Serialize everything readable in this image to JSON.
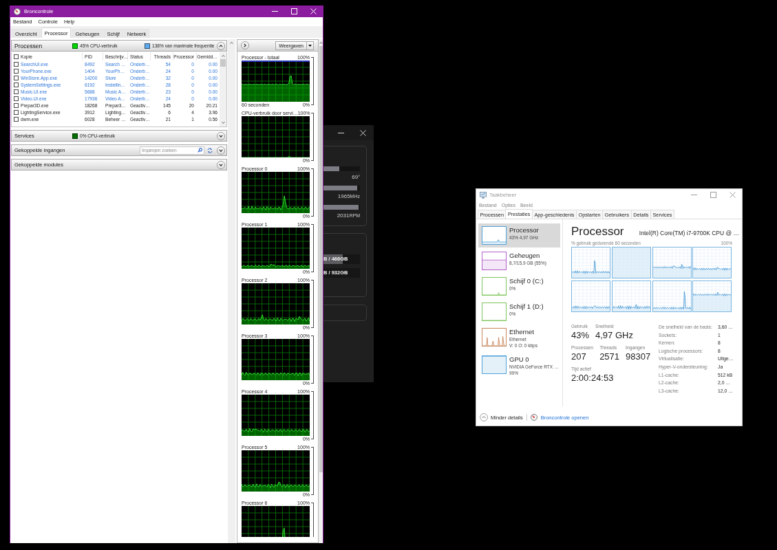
{
  "resource_monitor": {
    "title": "Broncontrole",
    "menu": [
      "Bestand",
      "Controle",
      "Help"
    ],
    "tabs": [
      {
        "label": "Overzicht",
        "selected": false
      },
      {
        "label": "Processor",
        "selected": true
      },
      {
        "label": "Geheugen",
        "selected": false
      },
      {
        "label": "Schijf",
        "selected": false
      },
      {
        "label": "Netwerk",
        "selected": false
      }
    ],
    "sections": [
      {
        "title": "Processen",
        "expanded": true,
        "indicators": [
          {
            "label": "45% CPU-verbruik",
            "color": "#00d400"
          },
          {
            "label": "138% van maximale frequentie",
            "color": "#5ea8ec"
          }
        ],
        "table": {
          "select_all_checked": false,
          "columns": [
            "Kopie",
            "PID",
            "Beschrijv…",
            "Status",
            "Threads",
            "Processor",
            "Gemidd…"
          ],
          "rows": [
            {
              "checked": false,
              "suspended": true,
              "cells": [
                "SearchUI.exe",
                "8492",
                "Search …",
                "Onderb…",
                "54",
                "0",
                "0.00"
              ]
            },
            {
              "checked": false,
              "suspended": true,
              "cells": [
                "YourPhone.exe",
                "1404",
                "YourPh…",
                "Onderb…",
                "24",
                "0",
                "0.00"
              ]
            },
            {
              "checked": false,
              "suspended": true,
              "cells": [
                "WinStore.App.exe",
                "14200",
                "Store",
                "Onderb…",
                "32",
                "0",
                "0.00"
              ]
            },
            {
              "checked": false,
              "suspended": true,
              "cells": [
                "SystemSettings.exe",
                "6192",
                "Instellin…",
                "Onderb…",
                "28",
                "0",
                "0.00"
              ]
            },
            {
              "checked": false,
              "suspended": true,
              "cells": [
                "Music.UI.exe",
                "5688",
                "Music A…",
                "Onderb…",
                "23",
                "0",
                "0.00"
              ]
            },
            {
              "checked": false,
              "suspended": true,
              "cells": [
                "Video.UI.exe",
                "17936",
                "Video A…",
                "Onderb…",
                "24",
                "0",
                "0.00"
              ]
            },
            {
              "checked": false,
              "suspended": false,
              "cells": [
                "Prepar3D.exe",
                "18268",
                "Prepar3…",
                "Geactiv…",
                "145",
                "20",
                "20.21"
              ]
            },
            {
              "checked": false,
              "suspended": false,
              "cells": [
                "LightingService.exe",
                "3912",
                "Lighting…",
                "Geactiv…",
                "6",
                "4",
                "3.96"
              ]
            },
            {
              "checked": false,
              "suspended": false,
              "cells": [
                "dwm.exe",
                "6028",
                "Beheer …",
                "Geactiv…",
                "21",
                "1",
                "0.56"
              ]
            }
          ]
        }
      },
      {
        "title": "Services",
        "expanded": false,
        "indicators": [
          {
            "label": "0% CPU-verbruik",
            "color": "#006e00"
          }
        ]
      },
      {
        "title": "Gekoppelde ingangen",
        "expanded": false,
        "search": {
          "placeholder": "Ingangen zoeken"
        }
      },
      {
        "title": "Gekoppelde modules",
        "expanded": false
      }
    ],
    "graph_panel": {
      "views_button": "Weergaven",
      "graphs": [
        {
          "title": "Processor - totaal",
          "max": "100%",
          "min": "0%",
          "timespan": "60 seconden"
        },
        {
          "title": "CPU-verbruik door servi…",
          "max": "100%",
          "min": "0%"
        },
        {
          "title": "Processor 0",
          "max": "100%",
          "min": "0%"
        },
        {
          "title": "Processor 1",
          "max": "100%",
          "min": "0%"
        },
        {
          "title": "Processor 2",
          "max": "100%",
          "min": "0%"
        },
        {
          "title": "Processor 3",
          "max": "100%",
          "min": "0%"
        },
        {
          "title": "Processor 4",
          "max": "100%",
          "min": "0%"
        },
        {
          "title": "Processor 5",
          "max": "100%",
          "min": "0%"
        },
        {
          "title": "Processor 6",
          "max": "100%"
        }
      ]
    }
  },
  "sensor_window": {
    "sensors": [
      {
        "level": 0.43,
        "value": "69",
        "unit": "°"
      },
      {
        "level": 0.92,
        "value": "1965",
        "unit": "MHz"
      },
      {
        "level": 0.97,
        "value": "2031",
        "unit": "RPM"
      }
    ],
    "disks": [
      {
        "level": 0.53,
        "label": "B / 466GB"
      },
      {
        "level": 0,
        "label": "B / 932GB"
      }
    ]
  },
  "task_manager": {
    "title": "Taakbeheer",
    "menu": [
      "Bestand",
      "Opties",
      "Beeld"
    ],
    "tabs": [
      {
        "label": "Processen",
        "selected": false
      },
      {
        "label": "Prestaties",
        "selected": true
      },
      {
        "label": "App-geschiedenis",
        "selected": false
      },
      {
        "label": "Opstarten",
        "selected": false
      },
      {
        "label": "Gebruikers",
        "selected": false
      },
      {
        "label": "Details",
        "selected": false
      },
      {
        "label": "Services",
        "selected": false
      }
    ],
    "resources": [
      {
        "name": "Processor",
        "details": [
          "43% 4,97 GHz"
        ],
        "color": "#4ea1d8",
        "selected": true
      },
      {
        "name": "Geheugen",
        "details": [
          "8,7/15,9 GB (55%)"
        ],
        "color": "#b25ec9",
        "selected": false
      },
      {
        "name": "Schijf 0 (C:)",
        "details": [
          "0%"
        ],
        "color": "#7fc55c",
        "selected": false
      },
      {
        "name": "Schijf 1 (D:)",
        "details": [
          "0%"
        ],
        "color": "#7fc55c",
        "selected": false
      },
      {
        "name": "Ethernet",
        "details": [
          "Ethernet",
          "V: 0 O: 0 kbps"
        ],
        "color": "#c8875c",
        "selected": false
      },
      {
        "name": "GPU 0",
        "details": [
          "NVIDIA GeForce RTX …",
          "99%"
        ],
        "color": "#4ea1d8",
        "selected": false
      }
    ],
    "detail": {
      "title": "Processor",
      "model": "Intel(R) Core(TM) i7-9700K CPU @ …",
      "graph_caption": "% gebruik gedurende 60 seconden",
      "graph_max": "100%",
      "stats": [
        [
          {
            "label": "Gebruik",
            "value": "43%"
          },
          {
            "label": "Snelheid",
            "value": "4,97 GHz"
          }
        ],
        [
          {
            "label": "Processen",
            "value": "207"
          },
          {
            "label": "Threads",
            "value": "2571"
          },
          {
            "label": "Ingangen",
            "value": "98307"
          }
        ],
        [
          {
            "label": "Tijd actief",
            "value": "2:00:24:53"
          }
        ]
      ],
      "properties": [
        {
          "label": "De snelheid van de basis:",
          "value": "3,60 …"
        },
        {
          "label": "Sockets:",
          "value": "1"
        },
        {
          "label": "Kernen:",
          "value": "8"
        },
        {
          "label": "Logische processors:",
          "value": "8"
        },
        {
          "label": "Virtualisatie:",
          "value": "Uitge…"
        },
        {
          "label": "Hyper-V-ondersteuning:",
          "value": "Ja"
        },
        {
          "label": "L1-cache:",
          "value": "512 kB"
        },
        {
          "label": "L2-cache:",
          "value": "2,0 …"
        },
        {
          "label": "L3-cache:",
          "value": "12,0 …"
        }
      ]
    },
    "footer": {
      "less_details": "Minder details",
      "open_link": "Broncontrole openen"
    }
  }
}
